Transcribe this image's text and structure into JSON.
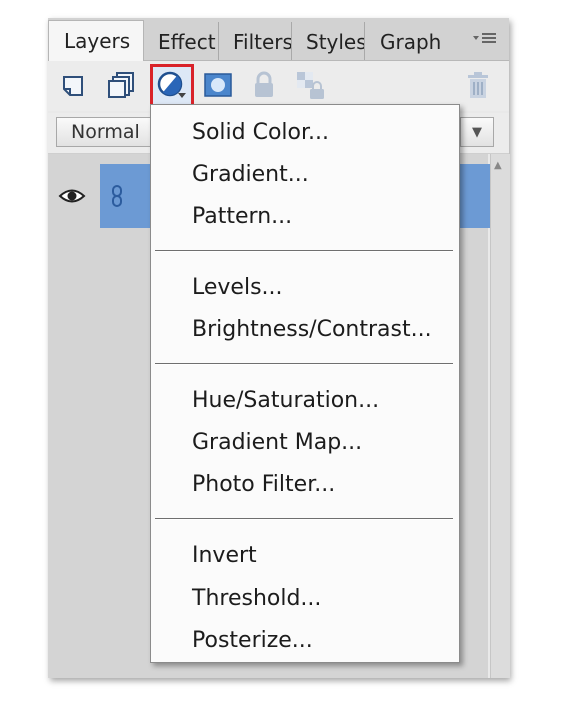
{
  "tabs": [
    {
      "label": "Layers",
      "active": true
    },
    {
      "label": "Effect",
      "active": false
    },
    {
      "label": "Filters",
      "active": false
    },
    {
      "label": "Styles",
      "active": false
    },
    {
      "label": "Graph",
      "active": false
    }
  ],
  "tab_menu_icon": "panel-menu-icon",
  "toolbar": {
    "icons": [
      "new-layer-icon",
      "new-group-icon",
      "adjustment-layer-icon",
      "layer-mask-icon",
      "lock-icon",
      "lock-transparency-icon",
      "trash-icon"
    ],
    "highlight_color": "#d9232a"
  },
  "blend_mode": {
    "value": "Normal"
  },
  "layers": [
    {
      "visible": true,
      "linked": true,
      "selected": true
    }
  ],
  "adjustment_menu": {
    "groups": [
      [
        "Solid Color...",
        "Gradient...",
        "Pattern..."
      ],
      [
        "Levels...",
        "Brightness/Contrast..."
      ],
      [
        "Hue/Saturation...",
        "Gradient Map...",
        "Photo Filter..."
      ],
      [
        "Invert",
        "Threshold...",
        "Posterize..."
      ]
    ]
  },
  "colors": {
    "selection": "#6c9ad4",
    "panel": "#e9e9e9",
    "menu_bg": "#fbfbfb"
  }
}
